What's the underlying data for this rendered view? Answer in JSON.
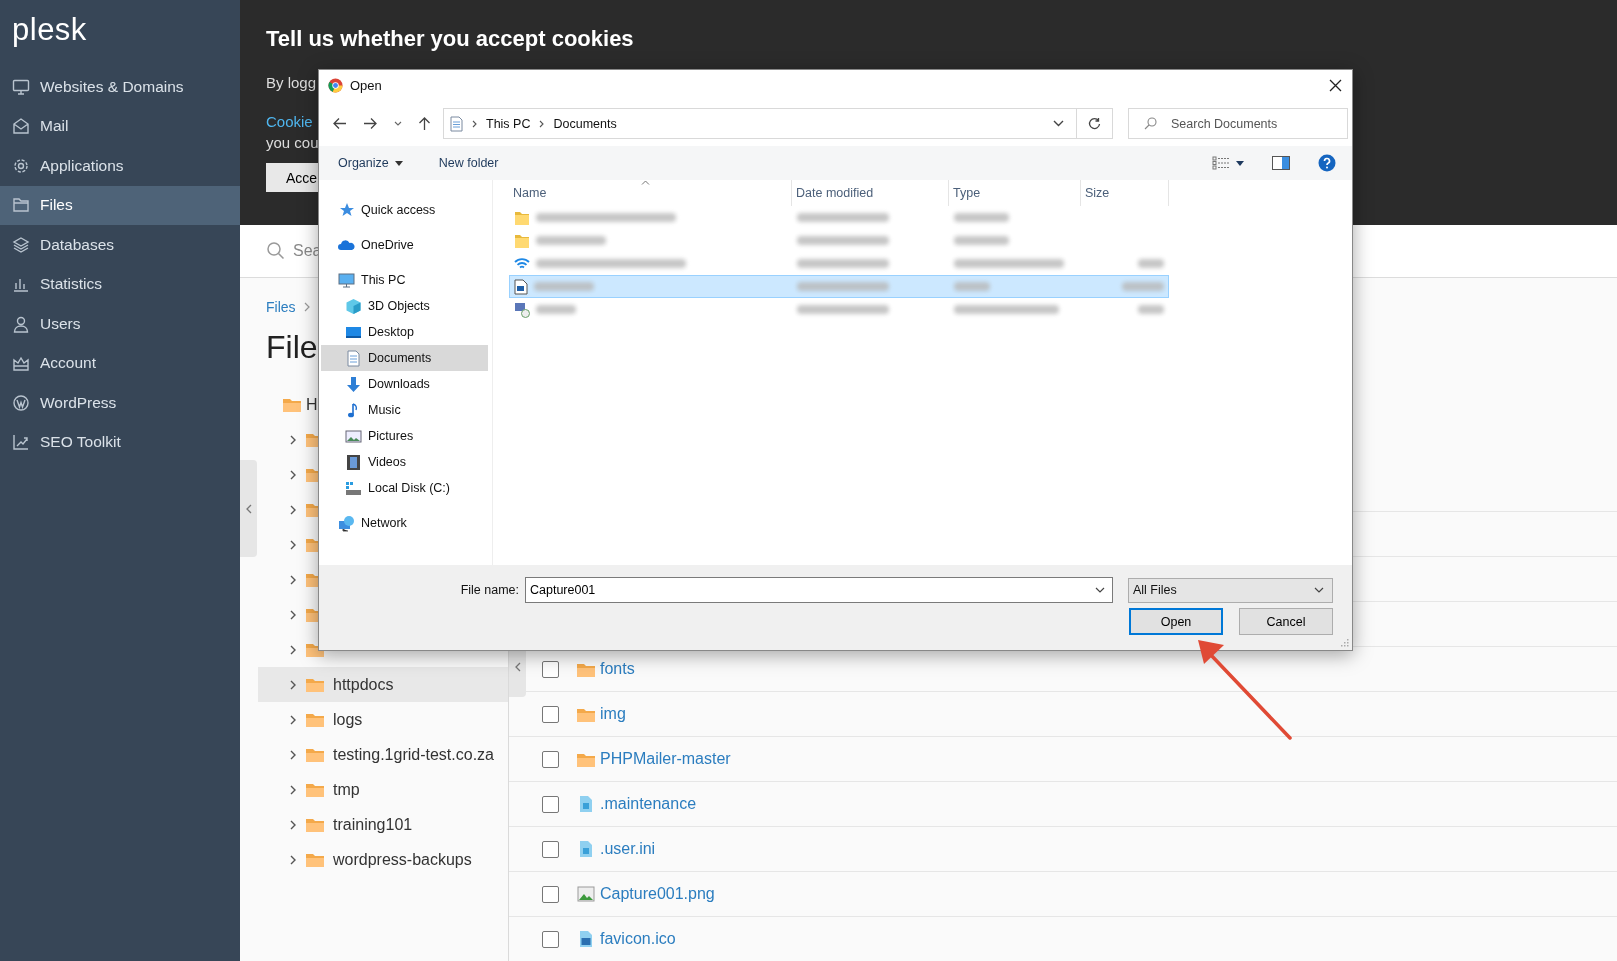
{
  "sidebar": {
    "logo": "plesk",
    "items": [
      {
        "label": "Websites & Domains",
        "selected": false
      },
      {
        "label": "Mail",
        "selected": false
      },
      {
        "label": "Applications",
        "selected": false
      },
      {
        "label": "Files",
        "selected": true
      },
      {
        "label": "Databases",
        "selected": false
      },
      {
        "label": "Statistics",
        "selected": false
      },
      {
        "label": "Users",
        "selected": false
      },
      {
        "label": "Account",
        "selected": false
      },
      {
        "label": "WordPress",
        "selected": false
      },
      {
        "label": "SEO Toolkit",
        "selected": false
      }
    ]
  },
  "cookie_banner": {
    "title": "Tell us whether you accept cookies",
    "text_1": "By logg",
    "link": "Cookie",
    "text_2": "you cou",
    "button": "Acce"
  },
  "search": {
    "placeholder": "Sea"
  },
  "breadcrumb": [
    "Files"
  ],
  "heading": "File",
  "tree": {
    "label": "H",
    "children": [
      {
        "expanded": false
      },
      {
        "expanded": false
      },
      {
        "expanded": false
      },
      {
        "expanded": false
      },
      {
        "expanded": false
      },
      {
        "expanded": false
      },
      {
        "expanded": false
      },
      {
        "label": "httpdocs",
        "expanded": false,
        "selected": true
      },
      {
        "label": "logs",
        "expanded": false,
        "selected": false
      },
      {
        "label": "testing.1grid-test.co.za",
        "expanded": false,
        "selected": false
      },
      {
        "label": "tmp",
        "expanded": false,
        "selected": false
      },
      {
        "label": "training101",
        "expanded": false,
        "selected": false
      },
      {
        "label": "wordpress-backups",
        "expanded": false,
        "selected": false
      }
    ]
  },
  "files": [
    {
      "name": "fonts",
      "kind": "folder",
      "checked": false
    },
    {
      "name": "img",
      "kind": "folder",
      "checked": false
    },
    {
      "name": "PHPMailer-master",
      "kind": "folder",
      "checked": false
    },
    {
      "name": ".maintenance",
      "kind": "file",
      "checked": false
    },
    {
      "name": ".user.ini",
      "kind": "file",
      "checked": false
    },
    {
      "name": "Capture001.png",
      "kind": "image",
      "checked": false
    },
    {
      "name": "favicon.ico",
      "kind": "binary",
      "checked": false
    }
  ],
  "dialog": {
    "title": "Open",
    "path": [
      "This PC",
      "Documents"
    ],
    "search": {
      "placeholder": "Search Documents"
    },
    "toolbar": [
      "Organize",
      "New folder"
    ],
    "nav": [
      {
        "label": "Quick access",
        "kind": "star",
        "selected": false
      },
      {
        "label": "OneDrive",
        "kind": "cloud",
        "selected": false
      },
      {
        "label": "This PC",
        "kind": "pc",
        "selected": false,
        "children": [
          {
            "label": "3D Objects",
            "kind": "cube",
            "selected": false
          },
          {
            "label": "Desktop",
            "kind": "desktop",
            "selected": false
          },
          {
            "label": "Documents",
            "kind": "document",
            "selected": true
          },
          {
            "label": "Downloads",
            "kind": "download",
            "selected": false
          },
          {
            "label": "Music",
            "kind": "music",
            "selected": false
          },
          {
            "label": "Pictures",
            "kind": "pictures",
            "selected": false
          },
          {
            "label": "Videos",
            "kind": "videos",
            "selected": false
          },
          {
            "label": "Local Disk (C:)",
            "kind": "disk",
            "selected": false
          }
        ]
      },
      {
        "label": "Network",
        "kind": "network",
        "selected": false
      }
    ],
    "columns": [
      "Name",
      "Date modified",
      "Type",
      "Size"
    ],
    "rows": [
      {
        "kind": "folder",
        "selected": false
      },
      {
        "kind": "folder",
        "selected": false
      },
      {
        "kind": "wireless",
        "selected": false
      },
      {
        "kind": "image",
        "selected": true
      },
      {
        "kind": "remote",
        "selected": false
      }
    ],
    "file_name_label": "File name:",
    "file_name": "Capture001",
    "file_type": "All Files",
    "buttons": [
      {
        "label": "Open",
        "default": true
      },
      {
        "label": "Cancel",
        "default": false
      }
    ]
  }
}
